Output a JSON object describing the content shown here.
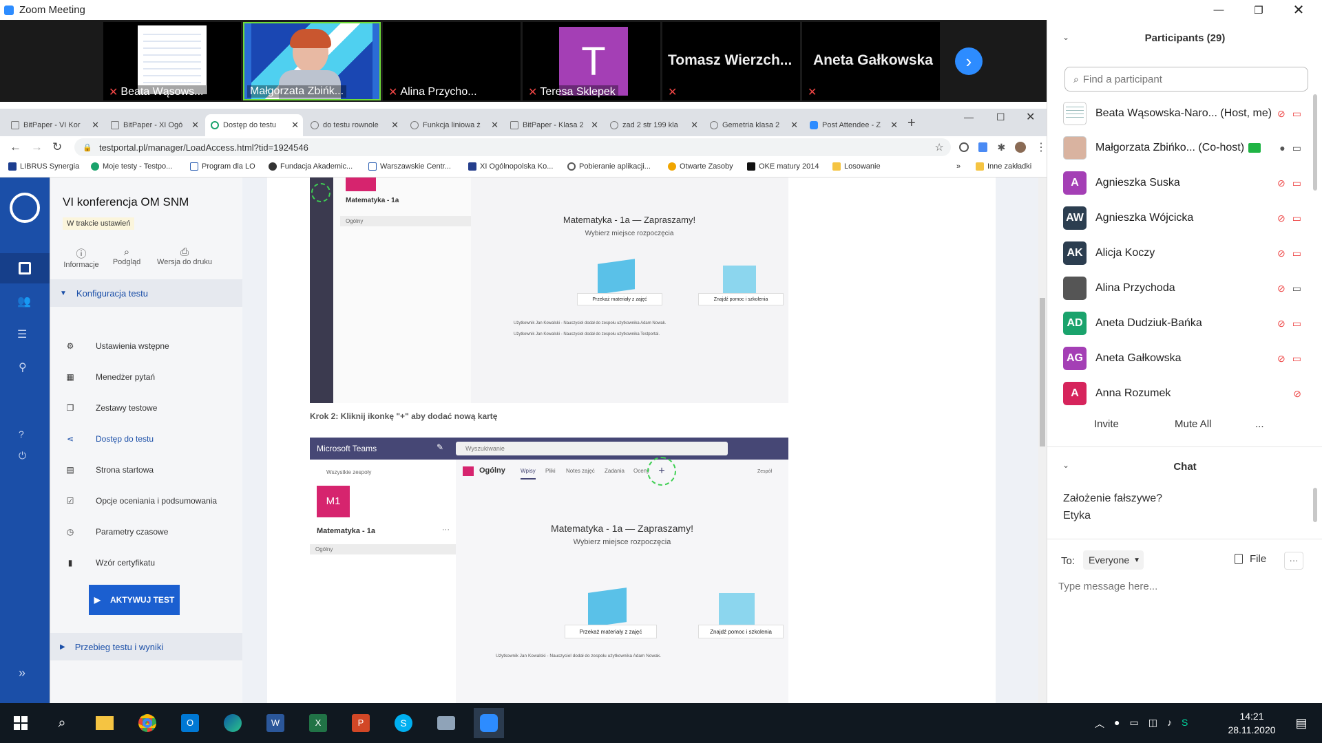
{
  "window": {
    "title": "Zoom Meeting"
  },
  "videos": [
    {
      "name": "Beata Wąsows..."
    },
    {
      "name": "Małgorzata Zbińk..."
    },
    {
      "name": "Alina Przycho..."
    },
    {
      "name": "Teresa Sklepek",
      "initial": "T"
    },
    {
      "name": "Tomasz  Wierzch..."
    },
    {
      "name": "Aneta Gałkowska"
    }
  ],
  "browser": {
    "tabs": [
      "BitPaper - VI Kor",
      "BitPaper - XI Ogó",
      "Dostęp do testu",
      "do testu rownole",
      "Funkcja liniowa ż",
      "BitPaper - Klasa 2",
      "zad 2 str 199 kla",
      "Gemetria klasa 2",
      "Post Attendee - Z"
    ],
    "url": "testportal.pl/manager/LoadAccess.html?tid=1924546",
    "bookmarks": [
      "LIBRUS Synergia",
      "Moje testy - Testpo...",
      "Program dla LO",
      "Fundacja Akademic...",
      "Warszawskie Centr...",
      "XI Ogólnopolska Ko...",
      "Pobieranie aplikacji...",
      "Otwarte Zasoby",
      "OKE matury 2014",
      "Losowanie"
    ],
    "other_bookmarks": "Inne zakładki"
  },
  "app": {
    "test_title": "VI konferencja OM SNM",
    "status_badge": "W trakcie ustawień",
    "tools": [
      "Informacje",
      "Podgląd",
      "Wersja do druku"
    ],
    "section_config": "Konfiguracja testu",
    "menu": [
      "Ustawienia wstępne",
      "Menedżer pytań",
      "Zestawy testowe",
      "Dostęp do testu",
      "Strona startowa",
      "Opcje oceniania i podsumowania",
      "Parametry czasowe",
      "Wzór certyfikatu"
    ],
    "activate_button": "AKTYWUJ TEST",
    "section_results": "Przebieg testu i wyniki"
  },
  "content": {
    "step2": "Krok 2: Kliknij ikonkę \"+\" aby dodać nową kartę",
    "teams1": {
      "team": "Matematyka - 1a",
      "channel": "Ogólny",
      "welcome": "Matematyka - 1a — Zapraszamy!",
      "sub": "Wybierz miejsce rozpoczęcia",
      "btn1": "Przekaż materiały z zajęć",
      "btn2": "Znajdź pomoc i szkolenia",
      "log1": "Użytkownik Jan Kowalski - Nauczyciel dodał do zespołu użytkownika Adam Nowak.",
      "log2": "Użytkownik Jan Kowalski - Nauczyciel dodał do zespołu użytkownika Testportal."
    },
    "teams2": {
      "app": "Microsoft Teams",
      "search": "Wyszukiwanie",
      "back": "Wszystkie zespoły",
      "avatar": "M1",
      "team": "Matematyka - 1a",
      "channel": "Ogólny",
      "channel_head": "Ogólny",
      "tabs": [
        "Wpisy",
        "Pliki",
        "Notes zajęć",
        "Zadania",
        "Oceny"
      ],
      "team_btn": "Zespół",
      "welcome": "Matematyka - 1a — Zapraszamy!",
      "sub": "Wybierz miejsce rozpoczęcia",
      "btn1": "Przekaż materiały z zajęć",
      "btn2": "Znajdź pomoc i szkolenia",
      "log1": "Użytkownik Jan Kowalski - Nauczyciel dodał do zespołu użytkownika Adam Nowak."
    }
  },
  "participants": {
    "header": "Participants (29)",
    "search_placeholder": "Find a participant",
    "list": [
      {
        "name": "Beata Wąsowska-Naro... (Host, me)",
        "color": "#ffffff"
      },
      {
        "name": "Małgorzata Zbińko... (Co-host)",
        "color": "#ffffff"
      },
      {
        "name": "Agnieszka Suska",
        "initials": "A",
        "color": "#a43fb5"
      },
      {
        "name": "Agnieszka Wójcicka",
        "initials": "AW",
        "color": "#2c3e50"
      },
      {
        "name": "Alicja Koczy",
        "initials": "AK",
        "color": "#2c3e50"
      },
      {
        "name": "Alina Przychoda",
        "color": "#555555"
      },
      {
        "name": "Aneta Dudziuk-Bańka",
        "initials": "AD",
        "color": "#1aa36c"
      },
      {
        "name": "Aneta Gałkowska",
        "initials": "AG",
        "color": "#a43fb5"
      },
      {
        "name": "Anna Rozumek",
        "initials": "A",
        "color": "#d6245c"
      }
    ],
    "invite": "Invite",
    "mute_all": "Mute All",
    "more": "..."
  },
  "chat": {
    "header": "Chat",
    "messages": [
      "Założenie fałszywe?",
      "Etyka"
    ],
    "to_label": "To:",
    "to_value": "Everyone",
    "file": "File",
    "more": "···",
    "placeholder": "Type message here..."
  },
  "taskbar": {
    "time": "14:21",
    "date": "28.11.2020"
  }
}
